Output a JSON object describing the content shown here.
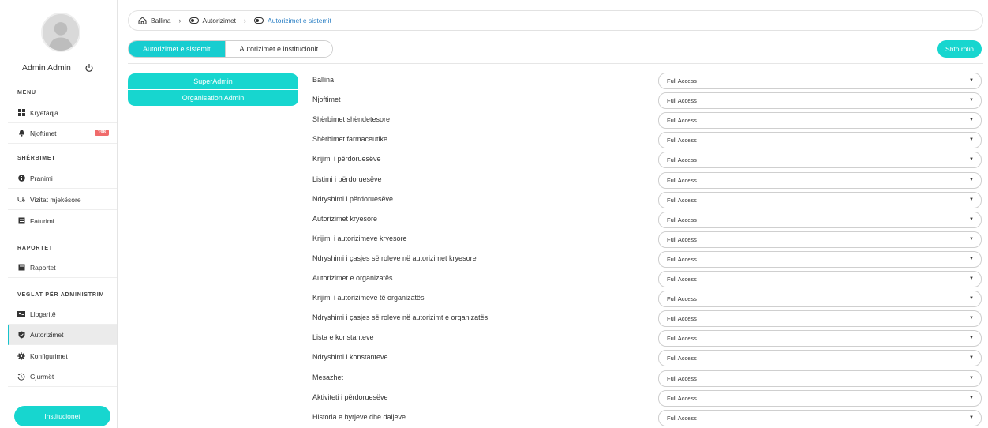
{
  "user": {
    "name": "Admin Admin"
  },
  "sidebar": {
    "sections": {
      "menu": "MENU",
      "services": "SHËRBIMET",
      "reports": "RAPORTET",
      "admin": "VEGLAT PËR ADMINISTRIM"
    },
    "items": [
      {
        "label": "Kryefaqja",
        "icon": "grid-icon"
      },
      {
        "label": "Njoftimet",
        "icon": "bell-icon",
        "badge": "198"
      },
      {
        "label": "Pranimi",
        "icon": "info-icon"
      },
      {
        "label": "Vizitat mjekësore",
        "icon": "stethoscope-icon"
      },
      {
        "label": "Faturimi",
        "icon": "document-icon"
      },
      {
        "label": "Raportet",
        "icon": "document-icon"
      },
      {
        "label": "Llogaritë",
        "icon": "id-card-icon"
      },
      {
        "label": "Autorizimet",
        "icon": "shield-icon",
        "active": true
      },
      {
        "label": "Konfigurimet",
        "icon": "gear-icon"
      },
      {
        "label": "Gjurmët",
        "icon": "history-icon"
      }
    ],
    "institutions_button": "Institucionet"
  },
  "breadcrumb": {
    "home": "Ballina",
    "level1": "Autorizimet",
    "current": "Autorizimet e sistemit"
  },
  "tabs": [
    "Autorizimet e sistemit",
    "Autorizimet e institucionit"
  ],
  "add_role_button": "Shto rolin",
  "roles": [
    "SuperAdmin",
    "Organisation Admin"
  ],
  "permissions": [
    {
      "label": "Ballina",
      "value": "Full Access"
    },
    {
      "label": "Njoftimet",
      "value": "Full Access"
    },
    {
      "label": "Shërbimet shëndetesore",
      "value": "Full Access"
    },
    {
      "label": "Shërbimet farmaceutike",
      "value": "Full Access"
    },
    {
      "label": "Krijimi i përdoruesëve",
      "value": "Full Access"
    },
    {
      "label": "Listimi i përdoruesëve",
      "value": "Full Access"
    },
    {
      "label": "Ndryshimi i përdoruesëve",
      "value": "Full Access"
    },
    {
      "label": "Autorizimet kryesore",
      "value": "Full Access"
    },
    {
      "label": "Krijimi i autorizimeve kryesore",
      "value": "Full Access"
    },
    {
      "label": "Ndryshimi i çasjes së roleve në autorizimet kryesore",
      "value": "Full Access"
    },
    {
      "label": "Autorizimet e organizatës",
      "value": "Full Access"
    },
    {
      "label": "Krijimi i autorizimeve të organizatës",
      "value": "Full Access"
    },
    {
      "label": "Ndryshimi i çasjes së roleve në autorizimt e organizatës",
      "value": "Full Access"
    },
    {
      "label": "Lista e konstanteve",
      "value": "Full Access"
    },
    {
      "label": "Ndryshimi i konstanteve",
      "value": "Full Access"
    },
    {
      "label": "Mesazhet",
      "value": "Full Access"
    },
    {
      "label": "Aktiviteti i përdoruesëve",
      "value": "Full Access"
    },
    {
      "label": "Historia e hyrjeve dhe daljeve",
      "value": "Full Access"
    }
  ],
  "colors": {
    "accent": "#17d6cf",
    "badge": "#f06b6b",
    "link": "#2a7fc4"
  }
}
